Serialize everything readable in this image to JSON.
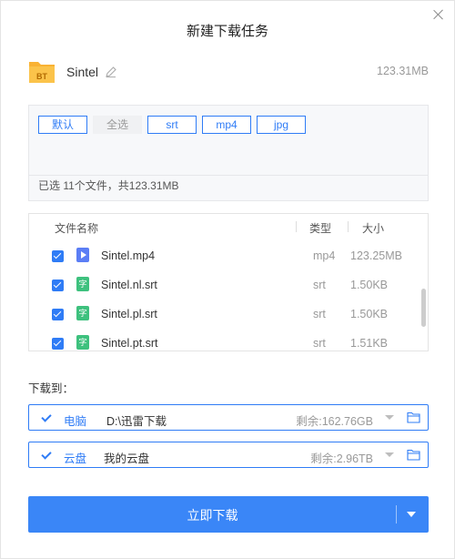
{
  "dialog": {
    "title": "新建下载任务"
  },
  "task": {
    "name": "Sintel",
    "total_size": "123.31MB",
    "folder_badge": "BT"
  },
  "filters": {
    "chips": [
      "默认",
      "全选",
      "srt",
      "mp4",
      "jpg"
    ],
    "selected_info": "已选 11个文件，共123.31MB"
  },
  "table": {
    "headers": {
      "name": "文件名称",
      "type": "类型",
      "size": "大小"
    },
    "rows": [
      {
        "name": "Sintel.mp4",
        "type": "mp4",
        "size": "123.25MB",
        "icon": "video-file-icon",
        "icon_text": ""
      },
      {
        "name": "Sintel.nl.srt",
        "type": "srt",
        "size": "1.50KB",
        "icon": "subtitle-file-icon",
        "icon_text": "字"
      },
      {
        "name": "Sintel.pl.srt",
        "type": "srt",
        "size": "1.50KB",
        "icon": "subtitle-file-icon",
        "icon_text": "字"
      },
      {
        "name": "Sintel.pt.srt",
        "type": "srt",
        "size": "1.51KB",
        "icon": "subtitle-file-icon",
        "icon_text": "字"
      }
    ]
  },
  "download_to": {
    "label": "下载到：",
    "pc": {
      "name": "电脑",
      "path": "D:\\迅雷下载",
      "free": "剩余:162.76GB"
    },
    "cloud": {
      "name": "云盘",
      "path": "我的云盘",
      "free": "剩余:2.96TB"
    }
  },
  "actions": {
    "download_now": "立即下载"
  },
  "colors": {
    "accent": "#3a86f7",
    "folder": "#f9b233",
    "video_icon": "#5b7ef5",
    "subtitle_icon": "#3ec17e"
  }
}
